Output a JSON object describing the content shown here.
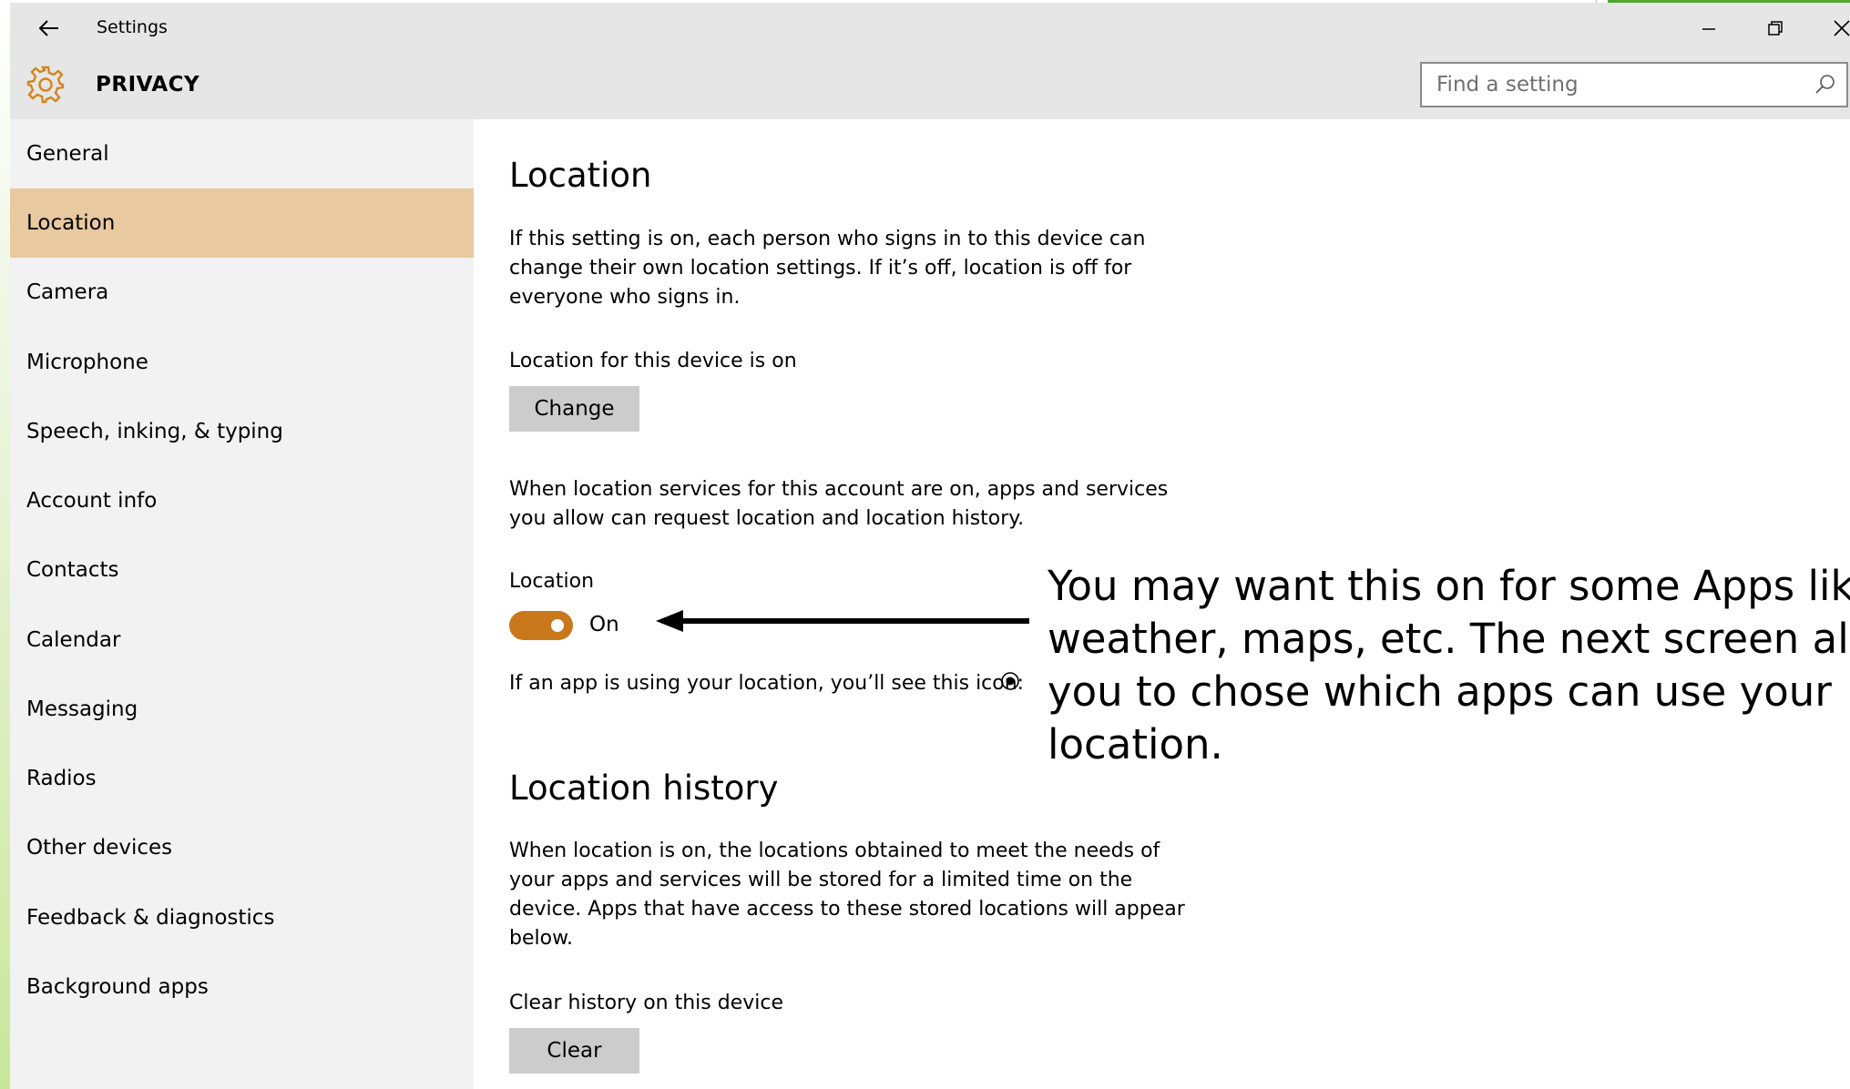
{
  "window": {
    "title": "Settings"
  },
  "header": {
    "title": "PRIVACY",
    "search_placeholder": "Find a setting"
  },
  "sidebar": {
    "items": [
      {
        "label": "General",
        "active": false
      },
      {
        "label": "Location",
        "active": true
      },
      {
        "label": "Camera",
        "active": false
      },
      {
        "label": "Microphone",
        "active": false
      },
      {
        "label": "Speech, inking, & typing",
        "active": false
      },
      {
        "label": "Account info",
        "active": false
      },
      {
        "label": "Contacts",
        "active": false
      },
      {
        "label": "Calendar",
        "active": false
      },
      {
        "label": "Messaging",
        "active": false
      },
      {
        "label": "Radios",
        "active": false
      },
      {
        "label": "Other devices",
        "active": false
      },
      {
        "label": "Feedback & diagnostics",
        "active": false
      },
      {
        "label": "Background apps",
        "active": false
      }
    ]
  },
  "main": {
    "location_heading": "Location",
    "location_intro_lines": [
      "If this setting is on, each person who signs in to this device can",
      "change their own location settings. If it’s off, location is off for",
      "everyone who signs in."
    ],
    "device_status": "Location for this device is on",
    "change_button": "Change",
    "services_lines": [
      "When location services for this account are on, apps and services",
      "you allow can request location and location history."
    ],
    "toggle_label": "Location",
    "toggle_state": "On",
    "toggle_on": true,
    "icon_note": "If an app is using your location, you’ll see this icon:",
    "history_heading": "Location history",
    "history_lines": [
      "When location is on, the locations obtained to meet the needs of",
      "your apps and services will be stored for a limited time on the",
      "device. Apps that have access to these stored locations will appear",
      "below."
    ],
    "clear_label": "Clear history on this device",
    "clear_button": "Clear"
  },
  "annotation": {
    "lines": [
      "You may want this on for some Apps like",
      "weather, maps, etc. The next screen allo",
      "you to chose which apps can use your",
      "location."
    ]
  },
  "colors": {
    "accent": "#c8781b",
    "active_nav": "#e8c9a0",
    "chrome": "#e6e6e6",
    "sidebar": "#f2f2f2",
    "button": "#cccccc"
  }
}
